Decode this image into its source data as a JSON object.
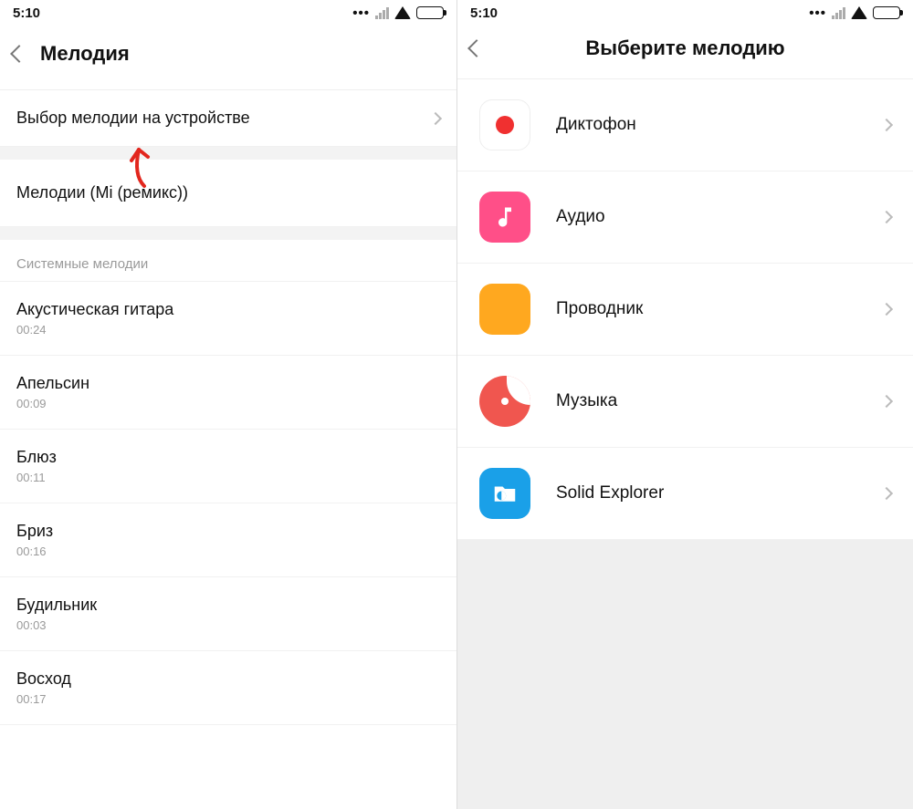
{
  "status": {
    "time": "5:10"
  },
  "left": {
    "title": "Мелодия",
    "choose_on_device": "Выбор мелодии на устройстве",
    "mi_remix": "Мелодии (Mi (ремикс))",
    "section_header": "Системные мелодии",
    "ringtones": [
      {
        "name": "Акустическая гитара",
        "duration": "00:24"
      },
      {
        "name": "Апельсин",
        "duration": "00:09"
      },
      {
        "name": "Блюз",
        "duration": "00:11"
      },
      {
        "name": "Бриз",
        "duration": "00:16"
      },
      {
        "name": "Будильник",
        "duration": "00:03"
      },
      {
        "name": "Восход",
        "duration": "00:17"
      }
    ]
  },
  "right": {
    "title": "Выберите мелодию",
    "apps": [
      {
        "name": "Диктофон",
        "icon": "recorder"
      },
      {
        "name": "Аудио",
        "icon": "audio"
      },
      {
        "name": "Проводник",
        "icon": "files"
      },
      {
        "name": "Музыка",
        "icon": "music"
      },
      {
        "name": "Solid Explorer",
        "icon": "solid"
      }
    ]
  }
}
